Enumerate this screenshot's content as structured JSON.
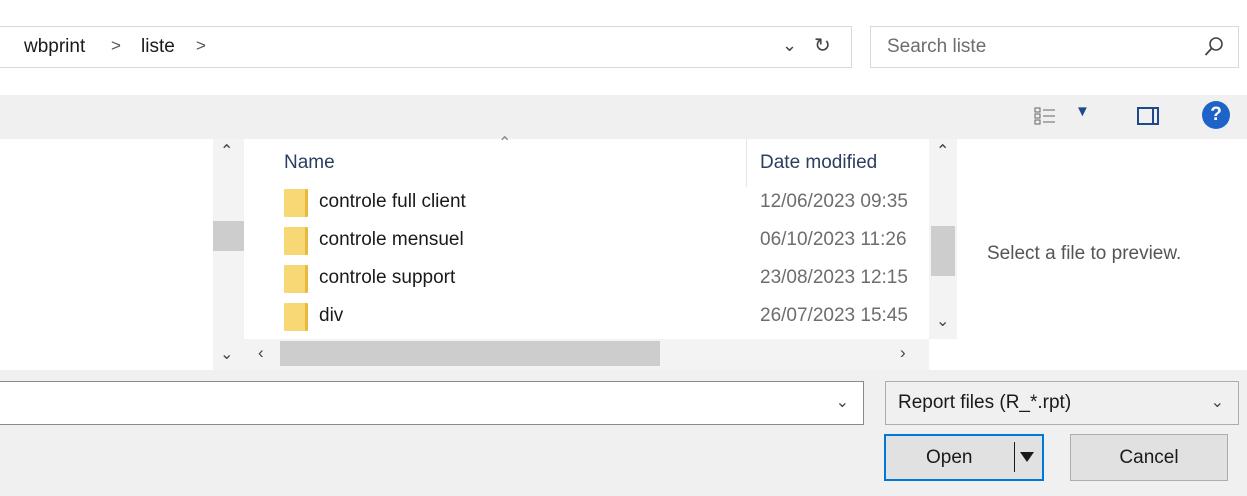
{
  "address": {
    "breadcrumbs": [
      "wbprint",
      "liste"
    ],
    "separator": ">"
  },
  "search": {
    "placeholder": "Search liste"
  },
  "file_list": {
    "columns": {
      "name": "Name",
      "date": "Date modified"
    },
    "rows": [
      {
        "name": "controle full client",
        "date": "12/06/2023 09:35"
      },
      {
        "name": "controle mensuel",
        "date": "06/10/2023 11:26"
      },
      {
        "name": "controle support",
        "date": "23/08/2023 12:15"
      },
      {
        "name": "div",
        "date": "26/07/2023 15:45"
      }
    ]
  },
  "preview": {
    "message": "Select a file to preview."
  },
  "bottom": {
    "filename_value": "",
    "filetype": "Report files (R_*.rpt)",
    "open_label": "Open",
    "cancel_label": "Cancel"
  },
  "icons": {
    "folder": "folder-icon",
    "search": "search-icon",
    "help": "help-icon",
    "view": "view-options-icon",
    "preview_pane": "preview-pane-icon"
  },
  "colors": {
    "accent": "#0078d7",
    "folder": "#f8d775",
    "help": "#1e64c8"
  }
}
